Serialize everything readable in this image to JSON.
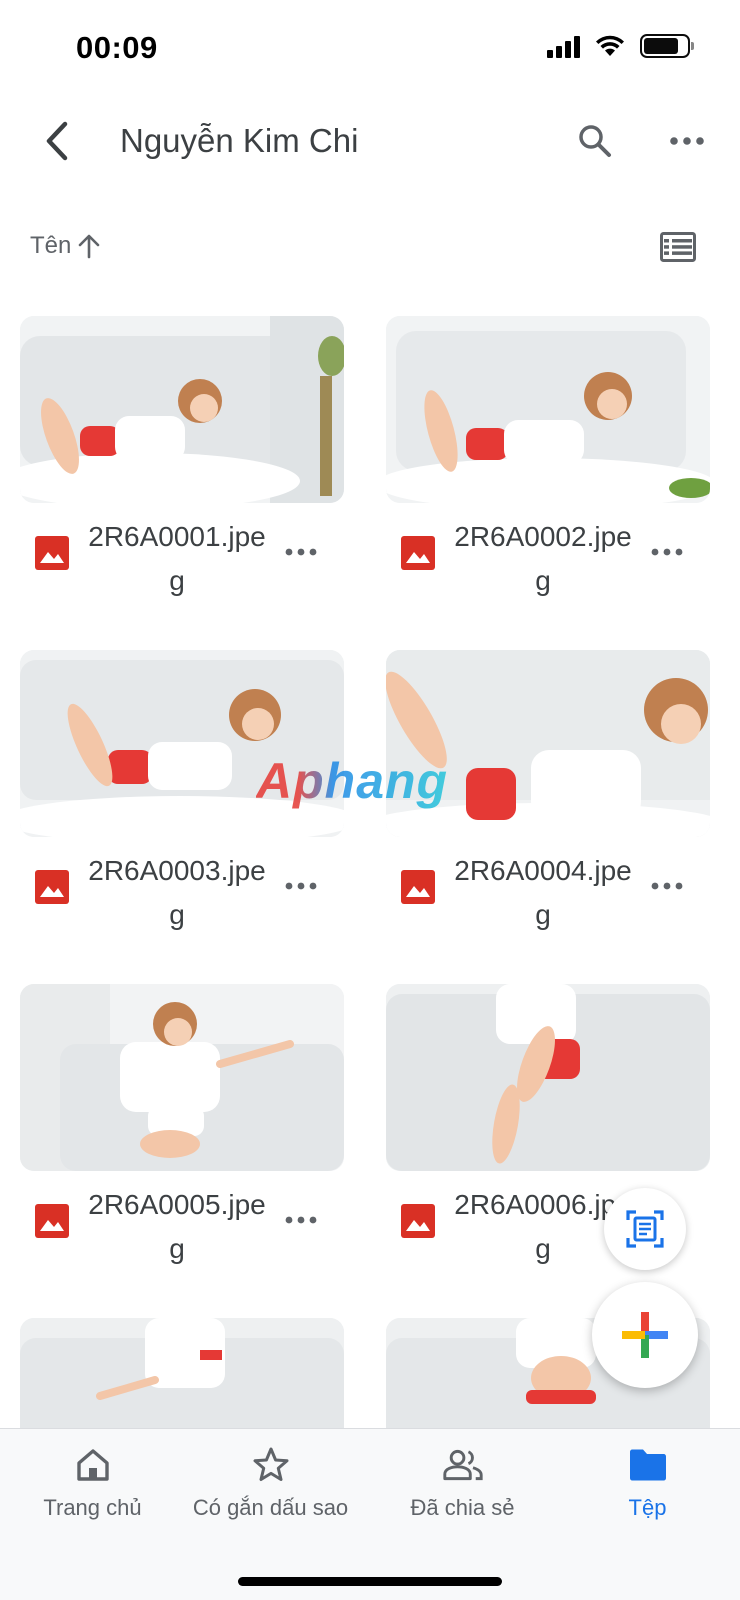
{
  "status_bar": {
    "time": "00:09"
  },
  "header": {
    "title": "Nguyễn Kim Chi"
  },
  "sort": {
    "label": "Tên"
  },
  "files": [
    {
      "name": "2R6A0001.jpeg"
    },
    {
      "name": "2R6A0002.jpeg"
    },
    {
      "name": "2R6A0003.jpeg"
    },
    {
      "name": "2R6A0004.jpeg"
    },
    {
      "name": "2R6A0005.jpeg"
    },
    {
      "name": "2R6A0006.jpeg"
    },
    {
      "name": ""
    },
    {
      "name": ""
    }
  ],
  "watermark": "Aphang",
  "bottom_nav": {
    "items": [
      {
        "label": "Trang chủ",
        "icon": "home-icon"
      },
      {
        "label": "Có gắn dấu sao",
        "icon": "star-icon"
      },
      {
        "label": "Đã chia sẻ",
        "icon": "people-icon"
      },
      {
        "label": "Tệp",
        "icon": "folder-icon"
      }
    ],
    "active": "Tệp"
  },
  "colors": {
    "accent": "#1a73e8",
    "image_icon": "#d93025",
    "text": "#3c4043",
    "nav_bg": "#f8f9fa"
  }
}
